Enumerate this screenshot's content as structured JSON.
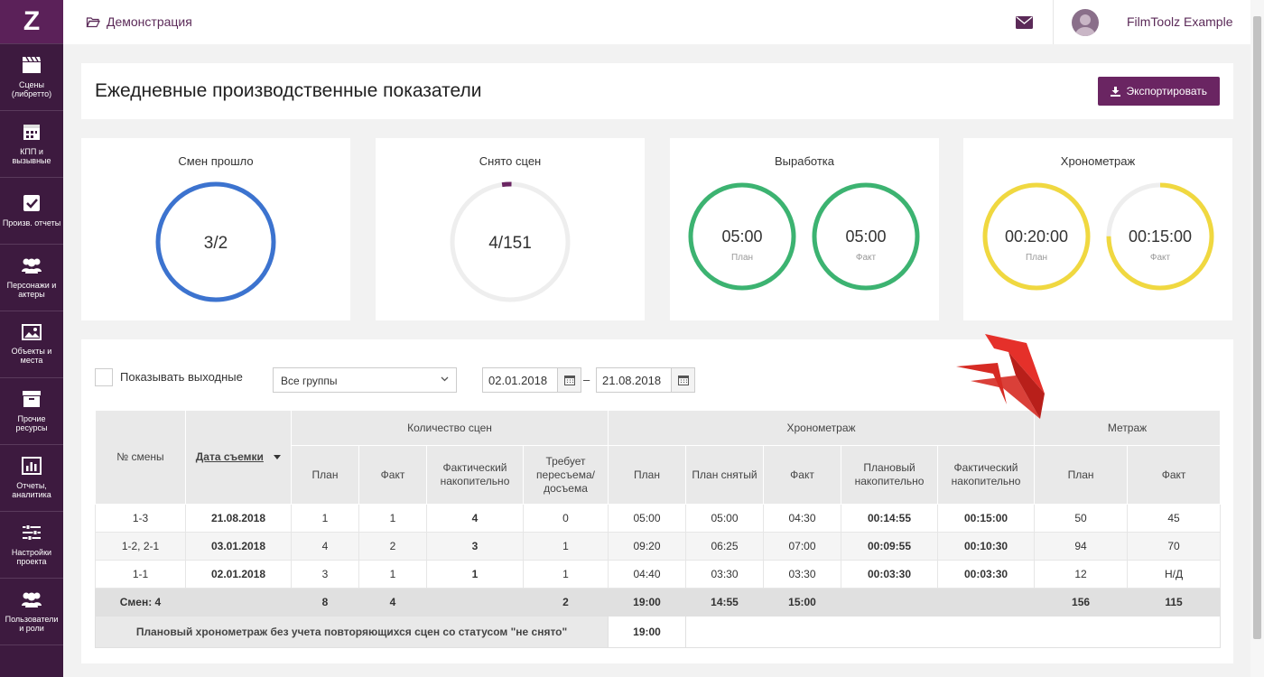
{
  "app": {
    "logo": "Z",
    "breadcrumb": "Демонстрация",
    "user_name": "FilmToolz Example"
  },
  "colors": {
    "sidebar": "#3d1a3f",
    "accent": "#6a2562",
    "blue": "#3c73cf",
    "green": "#3cb371",
    "yellow": "#f0d840",
    "track": "#eeeeee"
  },
  "sidebar": {
    "items": [
      {
        "label": "Сцены (либретто)",
        "icon": "clapperboard-icon"
      },
      {
        "label": "КПП и вызывные",
        "icon": "calendar-icon"
      },
      {
        "label": "Произв. отчеты",
        "icon": "checkbox-icon"
      },
      {
        "label": "Персонажи и актеры",
        "icon": "users-icon"
      },
      {
        "label": "Объекты и места",
        "icon": "image-icon"
      },
      {
        "label": "Прочие ресурсы",
        "icon": "archive-icon"
      },
      {
        "label": "Отчеты, аналитика",
        "icon": "bar-chart-icon"
      },
      {
        "label": "Настройки проекта",
        "icon": "sliders-icon"
      },
      {
        "label": "Пользователи и роли",
        "icon": "users-icon"
      }
    ]
  },
  "page": {
    "title": "Ежедневные производственные показатели",
    "export_label": "Экспортировать"
  },
  "kpis": {
    "shifts": {
      "title": "Смен прошло",
      "value": "3/2",
      "progress": 1.0
    },
    "scenes": {
      "title": "Снято сцен",
      "value": "4/151",
      "progress": 0.026
    },
    "output": {
      "title": "Выработка",
      "plan_value": "05:00",
      "plan_label": "План",
      "fact_value": "05:00",
      "fact_label": "Факт",
      "plan_progress": 1.0,
      "fact_progress": 1.0
    },
    "timing": {
      "title": "Хронометраж",
      "plan_value": "00:20:00",
      "plan_label": "План",
      "fact_value": "00:15:00",
      "fact_label": "Факт",
      "plan_progress": 1.0,
      "fact_progress": 0.75
    }
  },
  "filters": {
    "show_weekends_label": "Показывать выходные",
    "group_select": "Все группы",
    "date_from": "02.01.2018",
    "date_to": "21.08.2018",
    "range_dash": "–"
  },
  "table": {
    "h": {
      "shift_no": "№ смены",
      "shoot_date": "Дата съемки",
      "scenes_count": "Количество сцен",
      "timing": "Хронометраж",
      "footage": "Метраж",
      "plan": "План",
      "fact": "Факт",
      "fact_cum": "Фактический накопительно",
      "reshoot": "Требует пересъема/ досъема",
      "t_plan": "План",
      "t_plan_shot": "План снятый",
      "t_fact": "Факт",
      "t_plan_cum": "Плановый накопительно",
      "t_fact_cum": "Фактический накопительно",
      "m_plan": "План",
      "m_fact": "Факт"
    },
    "rows": [
      [
        "1-3",
        "21.08.2018",
        "1",
        "1",
        "4",
        "0",
        "05:00",
        "05:00",
        "04:30",
        "00:14:55",
        "00:15:00",
        "50",
        "45"
      ],
      [
        "1-2, 2-1",
        "03.01.2018",
        "4",
        "2",
        "3",
        "1",
        "09:20",
        "06:25",
        "07:00",
        "00:09:55",
        "00:10:30",
        "94",
        "70"
      ],
      [
        "1-1",
        "02.01.2018",
        "3",
        "1",
        "1",
        "1",
        "04:40",
        "03:30",
        "03:30",
        "00:03:30",
        "00:03:30",
        "12",
        "Н/Д"
      ]
    ],
    "totals": {
      "label": "Смен: 4",
      "plan": "8",
      "fact": "4",
      "reshoot": "2",
      "t_plan": "19:00",
      "t_plan_shot": "14:55",
      "t_fact": "15:00",
      "m_plan": "156",
      "m_fact": "115"
    },
    "note": {
      "label": "Плановый хронометраж без учета повторяющихся сцен со статусом \"не снято\"",
      "value": "19:00"
    }
  }
}
